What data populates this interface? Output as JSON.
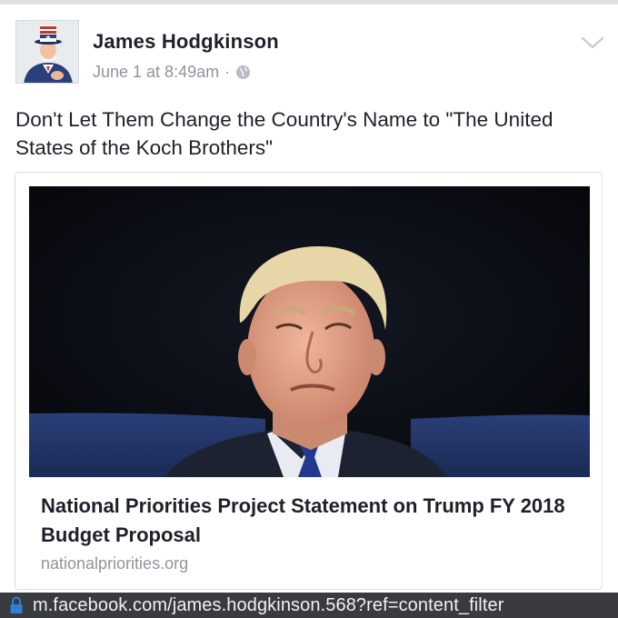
{
  "post": {
    "author": "James Hodgkinson",
    "timestamp": "June 1 at 8:49am",
    "separator": "·",
    "privacy_icon": "globe-icon",
    "options_icon": "chevron-down-icon",
    "avatar_icon": "uncle-sam-avatar",
    "text": "Don't Let Them Change the Country's Name to \"The United States of the Koch Brothers\""
  },
  "link_preview": {
    "image": "man-in-suit-photo",
    "title": "National Priorities Project Statement on Trump FY 2018 Budget Proposal",
    "domain": "nationalpriorities.org"
  },
  "address_bar": {
    "icon": "lock-icon",
    "url": "m.facebook.com/james.hodgkinson.568?ref=content_filter"
  },
  "colors": {
    "text": "#1d2129",
    "meta": "#90949c",
    "card_border": "#dddfe2",
    "address_bar_bg": "#3a3b3e",
    "lock": "#2f7fd8"
  }
}
